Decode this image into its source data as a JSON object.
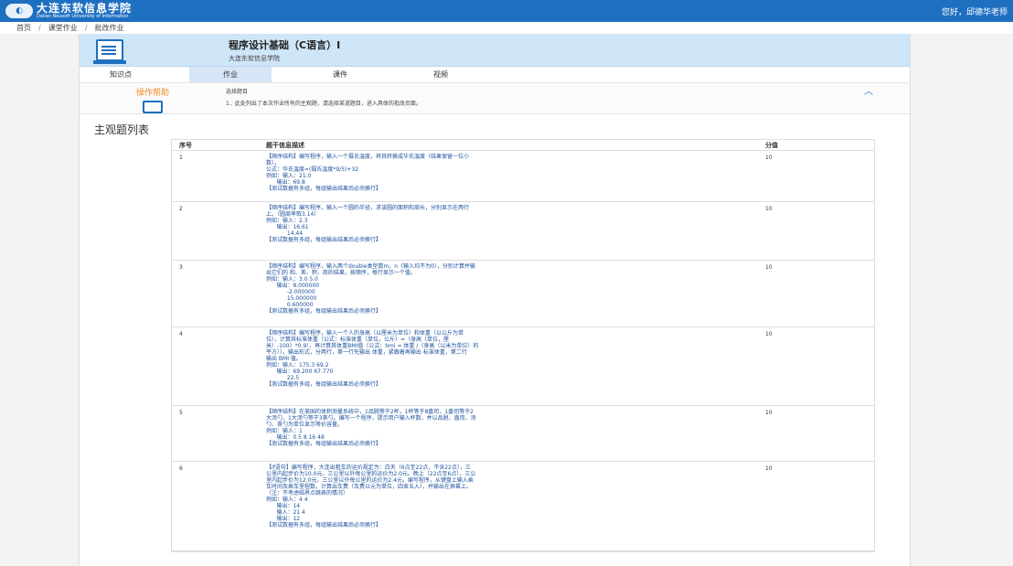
{
  "header": {
    "logo_text": "大连东软信息学院",
    "logo_subtext": "Dalian Neusoft University of Information",
    "greeting": "您好，邱德华老师"
  },
  "breadcrumb": [
    "首页",
    "课堂作业",
    "批改作业"
  ],
  "course": {
    "title": "程序设计基础（C语言）I",
    "school": "大连东软信息学院"
  },
  "tabs": [
    "知识点",
    "作业",
    "课件",
    "视频"
  ],
  "help": {
    "label": "操作帮助",
    "line1": "选择题目",
    "line2": "1．此处列出了本次作业所有的主观题，请选择某道题目，进入具体的批改页面。"
  },
  "section_title": "主观题列表",
  "table": {
    "headers": [
      "序号",
      "题干信息描述",
      "分值"
    ],
    "rows": [
      {
        "num": "1",
        "score": "10",
        "lines": [
          "【顺序结构】编写程序，输入一个摄氏温度，将其转换成华氏温度（结果保留一位小",
          "数）。",
          "公式：华氏温度=(摄氏温度*9/5)+32",
          "例如：输入：21.0",
          "      输出：69.8",
          "【测试数据有多组，每组输出结果后必须换行】"
        ]
      },
      {
        "num": "2",
        "score": "10",
        "lines": [
          "【顺序结构】编写程序，输入一个圆的半径，求该圆的面积和周长，分别显示在两行",
          "上。（圆周率取3.14）",
          "例如：输入：2.3",
          "      输出：16.61",
          "            14.44",
          "【测试数据有多组，每组输出结果后必须换行】"
        ]
      },
      {
        "num": "3",
        "score": "10",
        "lines": [
          "【顺序结构】编写程序，输入两个double类型数m，n（输入均不为0），分别计算并输",
          "出它们的 和、差、积、商的结果，按顺序，每行显示一个值。",
          "例如：输入：3.0 5.0",
          "      输出：8.000000",
          "            -2.000000",
          "            15.000000",
          "            0.600000",
          "【测试数据有多组，每组输出结果后必须换行】"
        ]
      },
      {
        "num": "4",
        "score": "10",
        "lines": [
          "【顺序结构】编写程序，输入一个人的身高（以厘米为单位）和体重（以公斤为单",
          "位），计算其标准体重（公式：标准体重（单位，公斤）=（身高（单位，厘",
          "米）-100）*0.9），再计算其体重BMI值（公式：bmi = 体重 /（身高（以米为单位）的",
          "平方））。输出形式，分两行，第一行先输出 体重，紧跟着再输出 标准体重，第二行",
          "输出 BMI 值。",
          "例如：输入：175.3 69.2",
          "      输出：69.200 67.770",
          "            22.5",
          "【测试数据有多组，每组输出结果后必须换行】"
        ]
      },
      {
        "num": "5",
        "score": "10",
        "lines": [
          "【顺序结构】在美国的体积测量系统中，1品脱等于2杯，1杯等于8盎司，1盎司等于2",
          "大汤勺，1大汤勺等于3茶勺。编写一个程序，提示用户输入杯数，并以品脱、盎司、汤",
          "勺、茶勺为单位显示等价容量。",
          "例如：输入：1",
          "      输出：0.5 8 16 48",
          "【测试数据有多组，每组输出结果后必须换行】"
        ]
      },
      {
        "num": "6",
        "score": "10",
        "lines": [
          "【if语句】编写程序，大连出租车的运价规定为：白天（6点至22点，不含22点），三",
          "公里内起步价为10.0元，三公里以外每公里的运价为2.0元。晚上（22点至6点），三公",
          "里内起步价为12.0元，三公里以外每公里的运价为2.4元。编写程序，从键盘上输入乘",
          "车时间及乘车里程数，计算出车费（车费以元为单位，四舍五入），并输出在屏幕上。",
          "（注：不考虑临界点跳表的情况）",
          "例如：输入：4 4",
          "      输出：14",
          "      输入：21 4",
          "      输出：12",
          "【测试数据有多组，每组输出结果后必须换行】"
        ]
      }
    ]
  },
  "colors": {
    "topbar": "#1f6fc1",
    "accent_orange": "#f08a24",
    "link_blue": "#1a4f9c",
    "header_bg": "#cfe5f8"
  }
}
